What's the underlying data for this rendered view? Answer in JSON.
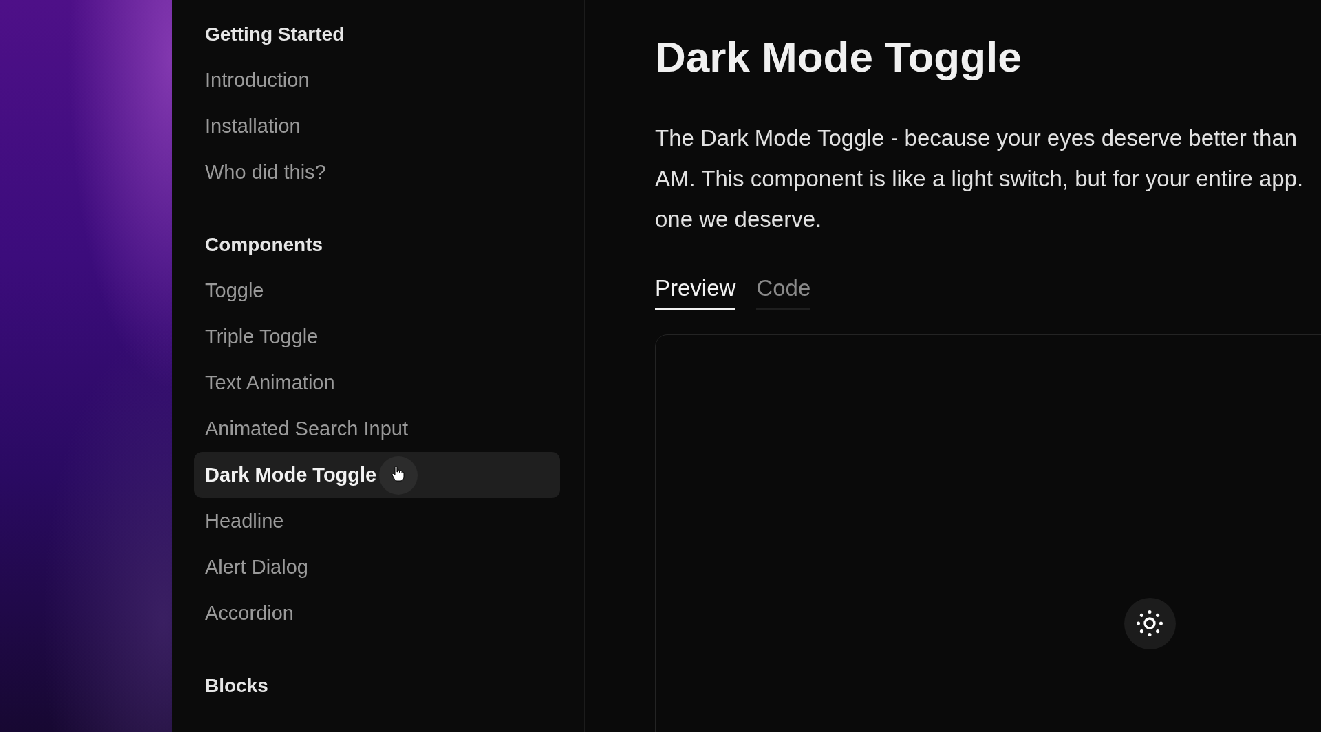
{
  "sidebar": {
    "sections": [
      {
        "title": "Getting Started",
        "items": [
          {
            "label": "Introduction",
            "selected": false
          },
          {
            "label": "Installation",
            "selected": false
          },
          {
            "label": "Who did this?",
            "selected": false
          }
        ]
      },
      {
        "title": "Components",
        "items": [
          {
            "label": "Toggle",
            "selected": false
          },
          {
            "label": "Triple Toggle",
            "selected": false
          },
          {
            "label": "Text Animation",
            "selected": false
          },
          {
            "label": "Animated Search Input",
            "selected": false
          },
          {
            "label": "Dark Mode Toggle",
            "selected": true
          },
          {
            "label": "Headline",
            "selected": false
          },
          {
            "label": "Alert Dialog",
            "selected": false
          },
          {
            "label": "Accordion",
            "selected": false
          }
        ]
      },
      {
        "title": "Blocks"
      }
    ]
  },
  "page": {
    "title": "Dark Mode Toggle",
    "description_lines": [
      "The Dark Mode Toggle - because your eyes deserve better than",
      "AM. This component is like a light switch, but for your entire app.",
      "one we deserve."
    ],
    "tabs": [
      {
        "label": "Preview",
        "selected": true
      },
      {
        "label": "Code",
        "selected": false
      }
    ]
  }
}
